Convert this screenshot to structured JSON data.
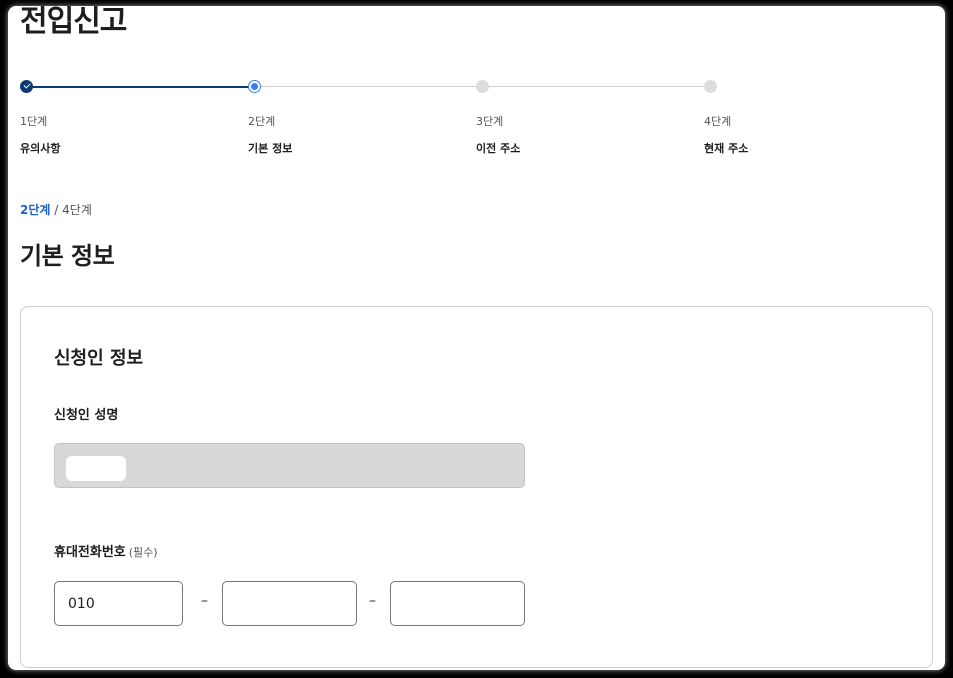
{
  "page": {
    "title": "전입신고"
  },
  "stepper": {
    "steps": [
      {
        "number": "1단계",
        "name": "유의사항",
        "state": "done"
      },
      {
        "number": "2단계",
        "name": "기본 정보",
        "state": "current"
      },
      {
        "number": "3단계",
        "name": "이전 주소",
        "state": "todo"
      },
      {
        "number": "4단계",
        "name": "현재 주소",
        "state": "todo"
      }
    ]
  },
  "progress": {
    "current": "2단계",
    "separator": "/",
    "total": "4단계"
  },
  "section": {
    "title": "기본 정보"
  },
  "applicant": {
    "card_title": "신청인 정보",
    "name_label": "신청인 성명",
    "phone_label": "휴대전화번호",
    "phone_required": "(필수)",
    "phone_part1": "010",
    "phone_part2": "",
    "phone_part3": "",
    "dash": "–"
  },
  "colors": {
    "primary": "#0b3a75",
    "accent": "#2463c6",
    "current_step": "#3d7ee8"
  }
}
